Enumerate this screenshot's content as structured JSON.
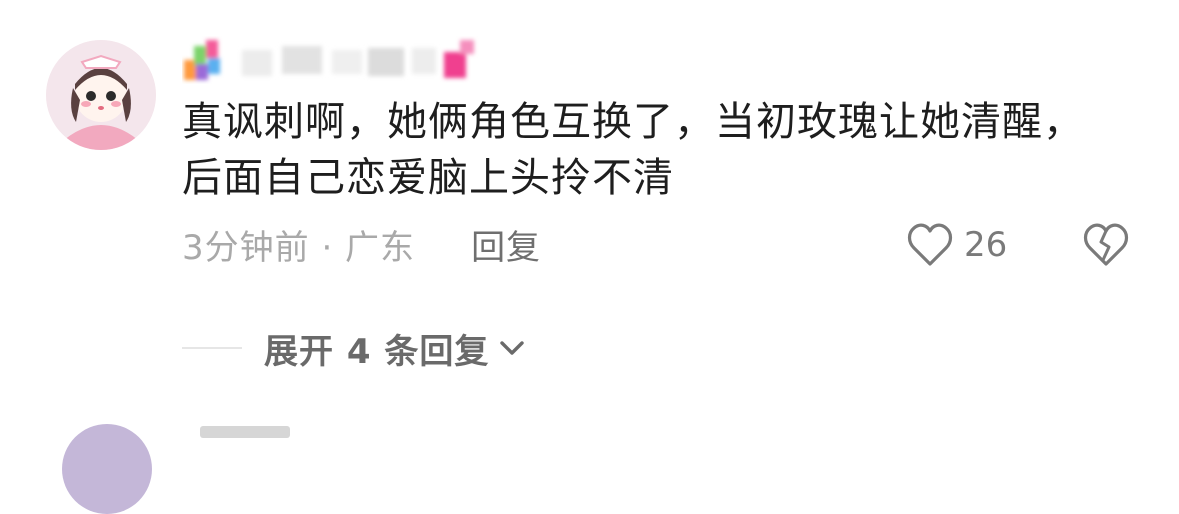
{
  "comment": {
    "text": "真讽刺啊，她俩角色互换了，当初玫瑰让她清醒，后面自己恋爱脑上头拎不清",
    "time_location": "3分钟前 · 广东",
    "reply_label": "回复",
    "like_count": "26",
    "icons": {
      "like": "heart-outline-icon",
      "dislike": "broken-heart-icon"
    }
  },
  "replies": {
    "expand_label": "展开 4 条回复",
    "icon": "chevron-down-icon"
  },
  "colors": {
    "text": "#1e1e1e",
    "meta": "#a9a9a9",
    "secondary": "#6f6f6f"
  }
}
